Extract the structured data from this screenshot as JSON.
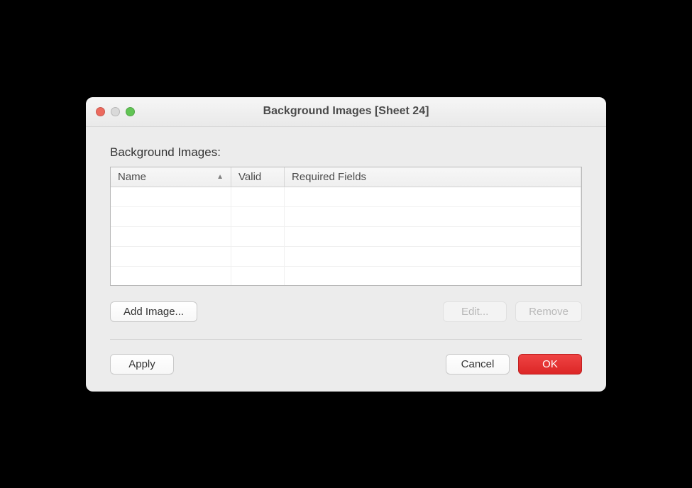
{
  "window": {
    "title": "Background Images [Sheet 24]"
  },
  "section": {
    "label": "Background Images:"
  },
  "table": {
    "columns": {
      "name": "Name",
      "valid": "Valid",
      "required_fields": "Required Fields"
    },
    "sort_indicator": "▲",
    "rows": []
  },
  "buttons": {
    "add_image": "Add Image...",
    "edit": "Edit...",
    "remove": "Remove",
    "apply": "Apply",
    "cancel": "Cancel",
    "ok": "OK"
  }
}
